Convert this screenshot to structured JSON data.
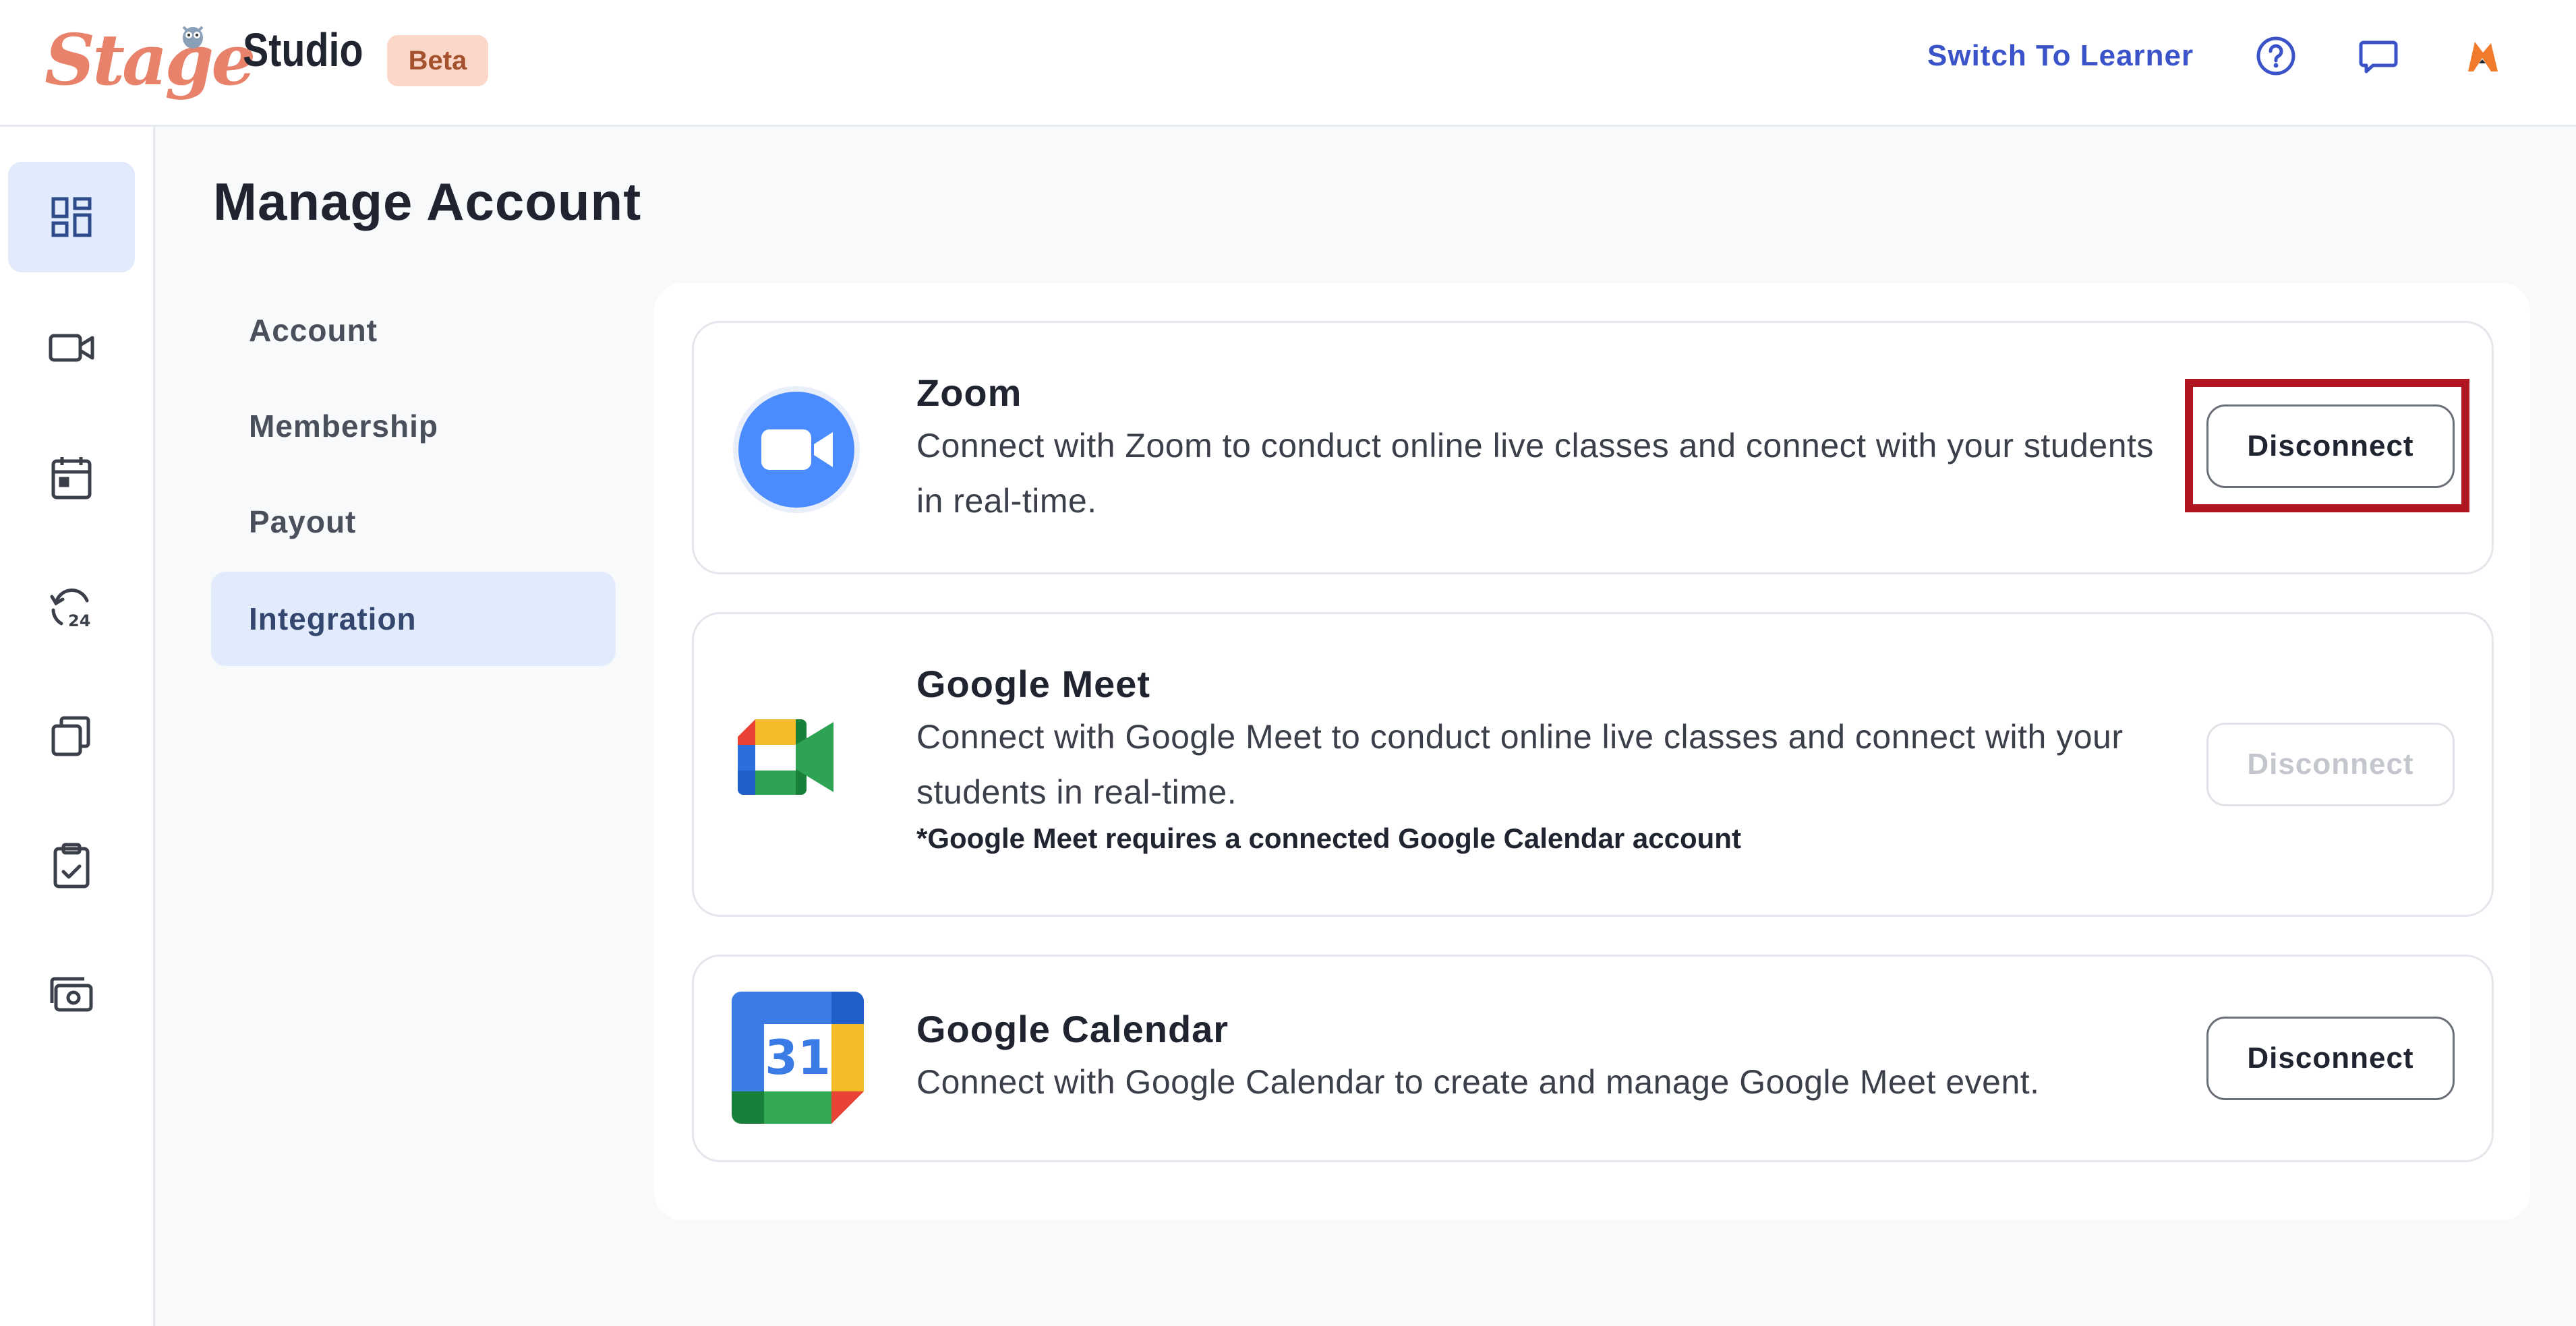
{
  "header": {
    "logo_text": "Stage",
    "studio_label": "Studio",
    "beta_badge": "Beta",
    "switch_link": "Switch To Learner",
    "icons": [
      "help-circle-icon",
      "chat-icon",
      "fox-avatar"
    ]
  },
  "sidebar": {
    "items": [
      {
        "name": "dashboard",
        "icon": "dashboard-icon",
        "active": true
      },
      {
        "name": "live-classes",
        "icon": "video-camera-icon",
        "active": false
      },
      {
        "name": "calendar",
        "icon": "calendar-icon",
        "active": false
      },
      {
        "name": "recordings",
        "icon": "history-24-icon",
        "active": false
      },
      {
        "name": "content",
        "icon": "copy-icon",
        "active": false
      },
      {
        "name": "assignments",
        "icon": "clipboard-check-icon",
        "active": false
      },
      {
        "name": "payments",
        "icon": "money-icon",
        "active": false
      }
    ]
  },
  "page": {
    "title": "Manage Account"
  },
  "subnav": {
    "items": [
      {
        "label": "Account",
        "active": false
      },
      {
        "label": "Membership",
        "active": false
      },
      {
        "label": "Payout",
        "active": false
      },
      {
        "label": "Integration",
        "active": true
      }
    ]
  },
  "integrations": [
    {
      "title": "Zoom",
      "description": "Connect with Zoom to conduct online live classes and connect with your students in real-time.",
      "note": "",
      "button": "Disconnect",
      "button_enabled": true,
      "icon": "zoom-icon"
    },
    {
      "title": "Google Meet",
      "description": "Connect with Google Meet to conduct online live classes and connect with your students in real-time.",
      "note": "*Google Meet requires a connected Google Calendar account",
      "button": "Disconnect",
      "button_enabled": false,
      "icon": "google-meet-icon"
    },
    {
      "title": "Google Calendar",
      "description": "Connect with Google Calendar to create and manage Google Meet event.",
      "note": "",
      "button": "Disconnect",
      "button_enabled": true,
      "icon": "google-calendar-icon",
      "icon_text": "31"
    }
  ],
  "colors": {
    "accent": "#3a53c9",
    "active_bg": "#e2ebfb",
    "beta_bg": "#fad7c8",
    "highlight": "#b0161f",
    "zoom_blue": "#4a8cff"
  }
}
